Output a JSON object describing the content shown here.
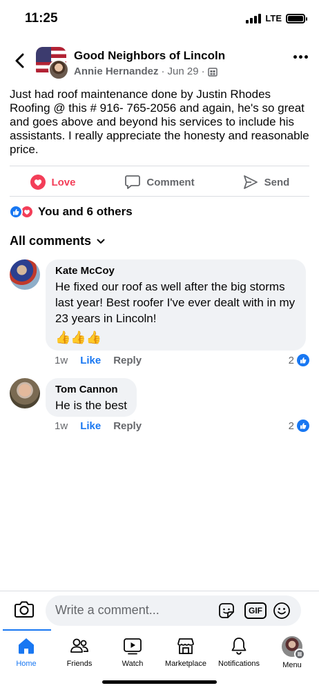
{
  "status_bar": {
    "time": "11:25",
    "network": "LTE"
  },
  "header": {
    "group_name": "Good Neighbors of Lincoln",
    "author": "Annie Hernandez",
    "separator": "·",
    "date": "Jun 29",
    "privacy_separator": "·"
  },
  "post": {
    "text": "Just had roof maintenance done by Justin Rhodes Roofing @ this # 916- 765-2056 and again, he's so great and goes above and beyond his services to include his assistants. I really appreciate the honesty and reasonable price."
  },
  "actions": {
    "love_label": "Love",
    "comment_label": "Comment",
    "send_label": "Send"
  },
  "reactions": {
    "summary": "You and 6 others"
  },
  "comments_section": {
    "filter_label": "All comments"
  },
  "comments": [
    {
      "name": "Kate McCoy",
      "text": "He fixed our roof as well after the big storms last year! Best roofer I've ever dealt with in my 23 years in Lincoln!",
      "emoji": "👍👍👍",
      "age": "1w",
      "like_label": "Like",
      "reply_label": "Reply",
      "like_count": "2"
    },
    {
      "name": "Tom Cannon",
      "text": "He is the best",
      "age": "1w",
      "like_label": "Like",
      "reply_label": "Reply",
      "like_count": "2"
    }
  ],
  "composer": {
    "placeholder": "Write a comment...",
    "gif_label": "GIF"
  },
  "tabs": [
    {
      "label": "Home",
      "active": true
    },
    {
      "label": "Friends"
    },
    {
      "label": "Watch"
    },
    {
      "label": "Marketplace"
    },
    {
      "label": "Notifications"
    },
    {
      "label": "Menu"
    }
  ],
  "colors": {
    "accent": "#1877f2",
    "love": "#f33e58",
    "secondary_text": "#65676b",
    "bubble_bg": "#f0f2f5"
  },
  "icons": [
    "back-arrow-icon",
    "more-icon",
    "heart-icon",
    "comment-icon",
    "send-icon",
    "camera-icon",
    "sticker-icon",
    "gif-icon",
    "emoji-icon",
    "home-icon",
    "friends-icon",
    "watch-icon",
    "marketplace-icon",
    "bell-icon"
  ]
}
